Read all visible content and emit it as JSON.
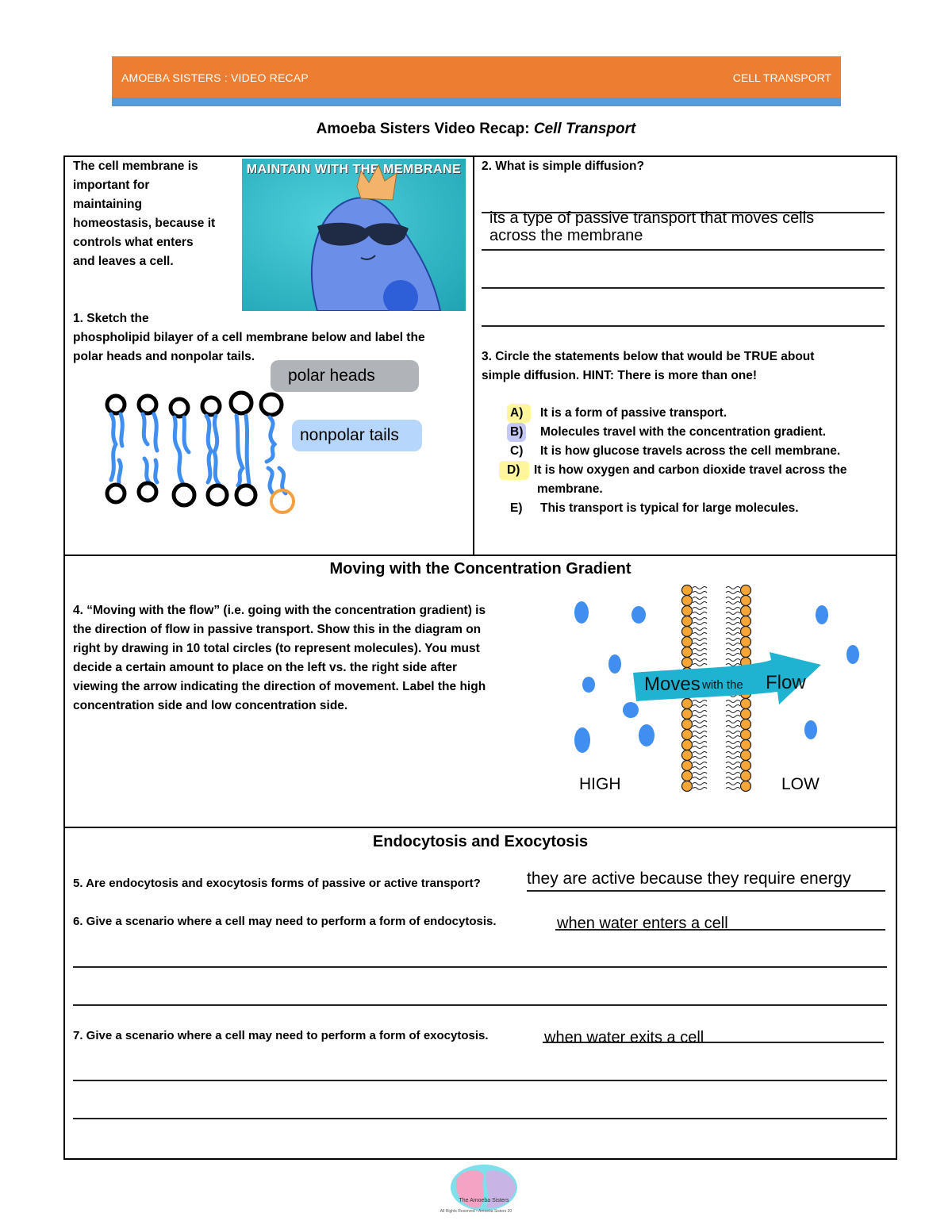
{
  "header": {
    "left": "AMOEBA SISTERS : VIDEO RECAP",
    "right": "CELL TRANSPORT",
    "colors": {
      "orange": "#ed7d31",
      "blue": "#5b9bd5"
    }
  },
  "title": {
    "main": "Amoeba Sisters Video Recap: ",
    "italic": "Cell Transport"
  },
  "intro": {
    "lines": [
      "The cell membrane is",
      "important for",
      "maintaining",
      "homeostasis, because it",
      "controls what enters",
      "and leaves a cell."
    ],
    "image_caption": "MAINTAIN WITH THE MEMBRANE"
  },
  "q1": {
    "lines": [
      "1. Sketch the",
      "phospholipid bilayer of a cell membrane below and label the",
      "polar heads and nonpolar tails."
    ],
    "labels": {
      "polar": "polar heads",
      "nonpolar": "nonpolar tails"
    }
  },
  "q2": {
    "question": "2. What is simple diffusion?",
    "answer_lines": [
      "its a type of passive transport that moves cells",
      "across the membrane"
    ]
  },
  "q3": {
    "lines": [
      "3. Circle the statements below that would be TRUE about",
      "simple diffusion. HINT: There is more than one!"
    ],
    "options": [
      {
        "key": "A)",
        "text": "It is a form of passive transport.",
        "highlight": "#fff59d"
      },
      {
        "key": "B)",
        "text": "Molecules travel with the concentration gradient.",
        "highlight": "#c5c8f5"
      },
      {
        "key": "C)",
        "text": "It is how glucose travels across the cell membrane.",
        "highlight": ""
      },
      {
        "key": "D)",
        "text": "It is how oxygen and carbon dioxide travel across the",
        "text2": "membrane.",
        "highlight": "#fff59d"
      },
      {
        "key": "E)",
        "text": "This transport is typical for large molecules.",
        "highlight": ""
      }
    ]
  },
  "section2": {
    "heading": "Moving with the Concentration Gradient",
    "q4_lines": [
      "4. “Moving with the flow” (i.e. going with the concentration gradient) is",
      "the direction of flow in passive transport. Show this in the diagram on",
      "right by drawing in 10 total circles (to represent molecules). You must",
      "decide a certain amount to place on the left vs. the right side after",
      "viewing the arrow indicating the direction of movement. Label the high",
      "concentration side and low concentration side."
    ],
    "diagram": {
      "arrow_text_1": "Moves",
      "arrow_text_2": "with the",
      "arrow_text_3": "Flow",
      "high": "HIGH",
      "low": "LOW"
    }
  },
  "section3": {
    "heading": "Endocytosis and Exocytosis",
    "q5": {
      "question": "5. Are endocytosis and exocytosis forms of passive or active transport?",
      "answer": "they are active because they require energy"
    },
    "q6": {
      "question": "6. Give a scenario where a cell may need to perform a form of endocytosis.",
      "answer": "when water enters a cell"
    },
    "q7": {
      "question": "7. Give a scenario where a cell may need to perform a form of exocytosis.",
      "answer": "when water exits a cell"
    }
  },
  "footer": {
    "logo_text": "The Amoeba Sisters",
    "rights": "All Rights Reserved • Amoeba Sisters 20"
  }
}
